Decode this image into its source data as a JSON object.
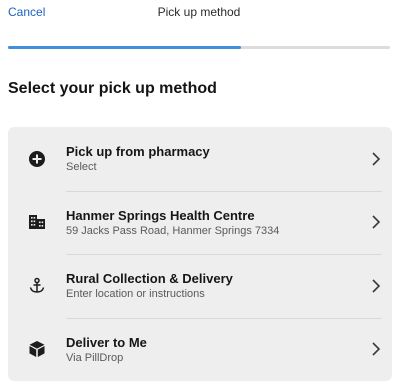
{
  "header": {
    "cancel_label": "Cancel",
    "title": "Pick up method"
  },
  "progress": {
    "fraction": 0.61
  },
  "heading": "Select your pick up method",
  "options": [
    {
      "title": "Pick up from pharmacy",
      "subtitle": "Select",
      "icon": "plus-circle-icon"
    },
    {
      "title": "Hanmer Springs Health Centre",
      "subtitle": "59 Jacks Pass Road, Hanmer Springs 7334",
      "icon": "building-icon"
    },
    {
      "title": "Rural Collection & Delivery",
      "subtitle": "Enter location or instructions",
      "icon": "anchor-icon"
    },
    {
      "title": "Deliver to Me",
      "subtitle": "Via PillDrop",
      "icon": "package-icon"
    }
  ],
  "colors": {
    "accent": "#3f8fdc",
    "link": "#1b62c2",
    "card": "#eeeeee"
  }
}
